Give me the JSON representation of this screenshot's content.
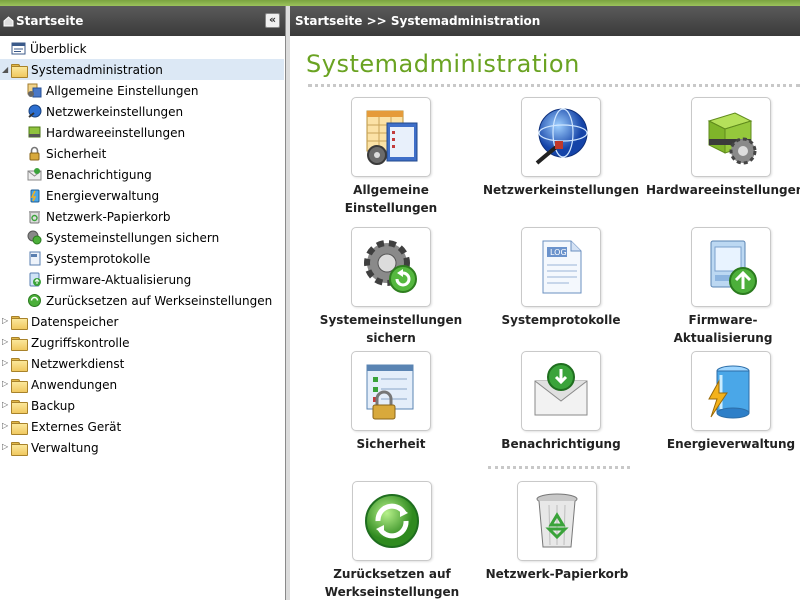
{
  "left_header": {
    "title": "Startseite",
    "collapse_glyph": "«"
  },
  "tree": {
    "overview": "Überblick",
    "systemadmin": {
      "label": "Systemadministration",
      "children": [
        {
          "label": "Allgemeine Einstellungen",
          "icon": "general-settings-icon"
        },
        {
          "label": "Netzwerkeinstellungen",
          "icon": "network-icon"
        },
        {
          "label": "Hardwareeinstellungen",
          "icon": "hardware-icon"
        },
        {
          "label": "Sicherheit",
          "icon": "lock-icon"
        },
        {
          "label": "Benachrichtigung",
          "icon": "notification-icon"
        },
        {
          "label": "Energieverwaltung",
          "icon": "power-icon"
        },
        {
          "label": "Netzwerk-Papierkorb",
          "icon": "recycle-bin-icon"
        },
        {
          "label": "Systemeinstellungen sichern",
          "icon": "backup-settings-icon"
        },
        {
          "label": "Systemprotokolle",
          "icon": "log-icon"
        },
        {
          "label": "Firmware-Aktualisierung",
          "icon": "firmware-update-icon"
        },
        {
          "label": "Zurücksetzen auf Werkseinstellungen",
          "icon": "factory-reset-icon"
        }
      ]
    },
    "folders": [
      "Datenspeicher",
      "Zugriffskontrolle",
      "Netzwerkdienst",
      "Anwendungen",
      "Backup",
      "Externes Gerät",
      "Verwaltung"
    ]
  },
  "breadcrumb": "Startseite >> Systemadministration",
  "page_title": "Systemadministration",
  "tiles": [
    {
      "label": "Allgemeine Einstellungen",
      "icon": "general-settings-icon"
    },
    {
      "label": "Netzwerkeinstellungen",
      "icon": "network-globe-icon"
    },
    {
      "label": "Hardwareeinstellungen",
      "icon": "hardware-gear-icon"
    },
    {
      "label": "Systemeinstellungen sichern",
      "icon": "gear-restore-icon"
    },
    {
      "label": "Systemprotokolle",
      "icon": "log-file-icon"
    },
    {
      "label": "Firmware-Aktualisierung",
      "icon": "firmware-update-icon"
    },
    {
      "label": "Sicherheit",
      "icon": "security-lock-icon"
    },
    {
      "label": "Benachrichtigung",
      "icon": "mail-notification-icon"
    },
    {
      "label": "Energieverwaltung",
      "icon": "battery-power-icon"
    },
    {
      "label": "Zurücksetzen auf Werkseinstellungen",
      "icon": "reset-arrows-icon"
    },
    {
      "label": "Netzwerk-Papierkorb",
      "icon": "recycle-bin-icon"
    }
  ],
  "colors": {
    "accent_green": "#6aa322",
    "header_dark": "#444444",
    "selected_bg": "#dce8f5"
  }
}
